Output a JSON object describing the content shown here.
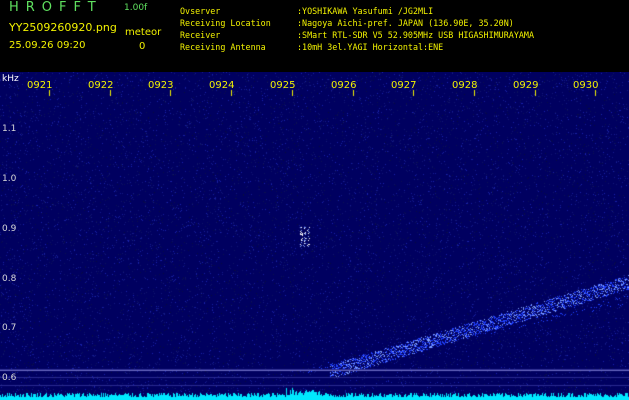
{
  "header": {
    "app_title": "HROFFT",
    "version": "1.00f",
    "filename": "YY2509260920.png",
    "datetime": "25.09.26 09:20",
    "meteor_label": "meteor",
    "meteor_count": "0"
  },
  "station": [
    {
      "key": "Ovserver",
      "value": ":YOSHIKAWA Yasufumi /JG2MLI"
    },
    {
      "key": "Receiving Location",
      "value": ":Nagoya Aichi-pref. JAPAN (136.90E, 35.20N)"
    },
    {
      "key": "Receiver",
      "value": ":SMart RTL-SDR V5 52.905MHz USB HIGASHIMURAYAMA"
    },
    {
      "key": "Receiving Antenna",
      "value": ":10mH 3el.YAGI Horizontal:ENE"
    }
  ],
  "spectrogram": {
    "unit_label": "kHz",
    "time_labels": [
      "0921",
      "0922",
      "0923",
      "0924",
      "0925",
      "0926",
      "0927",
      "0928",
      "0929",
      "0930"
    ],
    "freq_labels": [
      "1.1",
      "1.0",
      "0.9",
      "0.8",
      "0.7",
      "0.6"
    ],
    "colors": {
      "background": "#000060",
      "signal": "#2040ff",
      "strong": "#80a0ff",
      "baseline": "#00e8ff",
      "grid": "#2a2a90"
    }
  }
}
